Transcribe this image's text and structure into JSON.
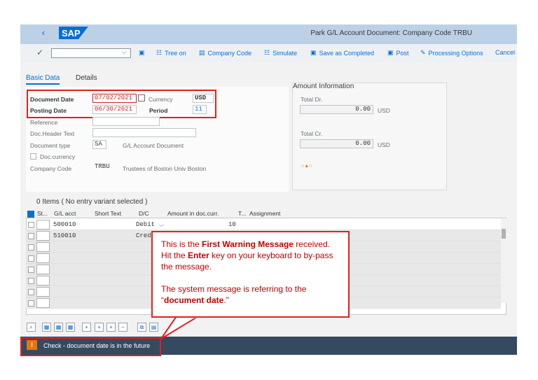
{
  "header": {
    "title": "Park G/L Account Document: Company Code TRBU",
    "logo_text": "SAP"
  },
  "toolbar": {
    "tree_on": "Tree on",
    "company_code": "Company Code",
    "simulate": "Simulate",
    "save_completed": "Save as Completed",
    "post": "Post",
    "processing_options": "Processing Options",
    "cancel": "Cancel"
  },
  "tabs": {
    "basic": "Basic Data",
    "details": "Details"
  },
  "form": {
    "document_date_label": "Document Date",
    "document_date": "07/02/2021",
    "currency_label": "Currency",
    "currency": "USD",
    "posting_date_label": "Posting Date",
    "posting_date": "06/30/2021",
    "period_label": "Period",
    "period": "11",
    "reference_label": "Reference",
    "header_text_label": "Doc.Header Text",
    "document_type_label": "Document type",
    "document_type": "SA",
    "document_type_desc": "G/L Account Document",
    "doc_currency_label": "Doc.currency",
    "company_code_label": "Company Code",
    "company_code": "TRBU",
    "company_code_desc": "Trustees of Boston Univ Boston"
  },
  "amount": {
    "title": "Amount Information",
    "total_dr_label": "Total Dr.",
    "total_dr": "0.00",
    "total_dr_cur": "USD",
    "total_cr_label": "Total Cr.",
    "total_cr": "0.00",
    "total_cr_cur": "USD"
  },
  "items": {
    "title": "0 Items ( No entry variant selected )",
    "columns": [
      "St...",
      "G/L acct",
      "Short Text",
      "D/C",
      "Amount in doc.curr.",
      "T...",
      "Assignment"
    ],
    "rows": [
      {
        "gl": "500010",
        "dc": "Debit",
        "amount": "10"
      },
      {
        "gl": "510010",
        "dc": "Cred",
        "amount": ""
      }
    ]
  },
  "status": {
    "message": "Check - document date is in the future"
  },
  "callout": {
    "line1_pre": "This is the ",
    "line1_bold": "First Warning Message",
    "line2_pre": " received. Hit the ",
    "line2_bold": "Enter",
    "line2_post": " key on your keyboard to by-pass the message.",
    "line3_pre": "The system message is referring to the “",
    "line3_bold": "document date",
    "line3_post": ".”"
  },
  "colors": {
    "accent": "#0a6ed1",
    "status_bar": "#354a5f",
    "highlight": "#e02020",
    "warning": "#e9730c"
  }
}
